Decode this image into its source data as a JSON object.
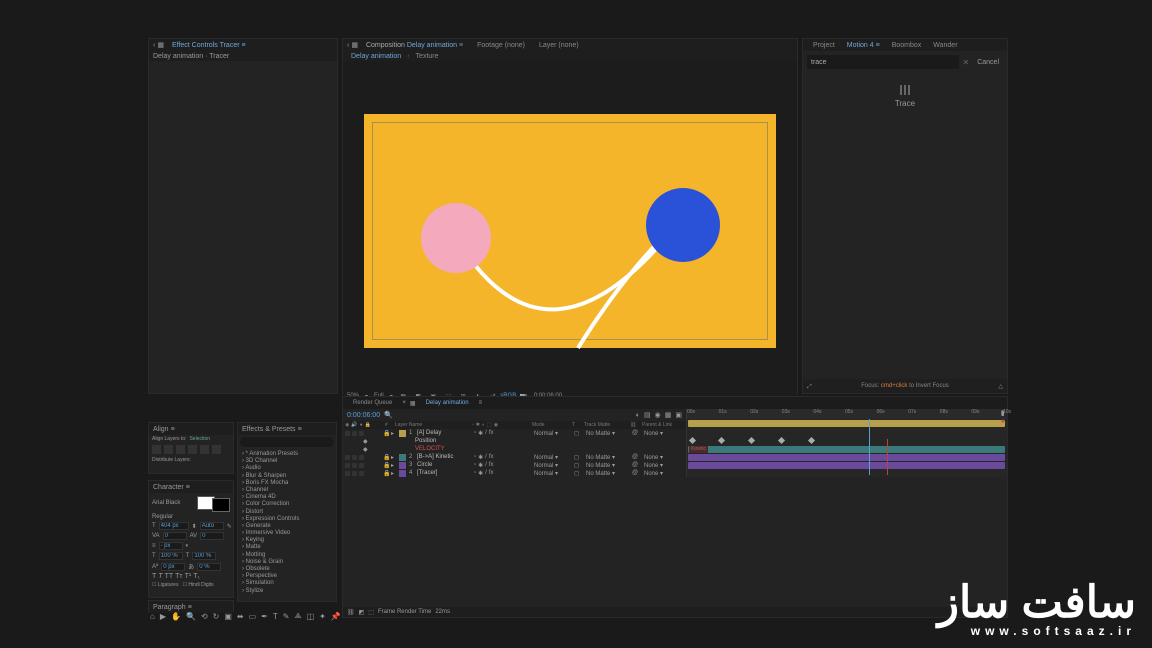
{
  "effect_controls": {
    "tab_prefix": "Effect Controls",
    "tab_layer": "Tracer",
    "breadcrumb": "Delay animation · Tracer"
  },
  "composition": {
    "tab_prefix": "Composition",
    "tab_name": "Delay animation",
    "tab_footage": "Footage (none)",
    "tab_layer": "Layer (none)",
    "subtab_delay": "Delay animation",
    "subtab_texture": "Texture"
  },
  "viewer_controls": {
    "zoom": "50%",
    "resolution": "Full",
    "colorspace": "sRGB",
    "timecode": "0:00:06:00"
  },
  "right_panel": {
    "tabs": [
      "Project",
      "Motion 4",
      "Boombox",
      "Wander"
    ],
    "active_tab_index": 1,
    "search_value": "trace",
    "cancel": "Cancel",
    "action_label": "Trace",
    "hint_prefix": "Focus:",
    "hint_cmd": "cmd+click",
    "hint_suffix": "to Invert Focus"
  },
  "timeline": {
    "tab_render": "Render Queue",
    "tab_comp": "Delay animation",
    "current_time": "0:00:06:00",
    "columns": {
      "layer_name": "Layer Name",
      "mode": "Mode",
      "trk": "Track Matte",
      "parent": "Parent & Link"
    },
    "layers": [
      {
        "idx": "1",
        "name": "[A] Delay",
        "color": "#b8a04a",
        "mode": "Normal",
        "trk": "No Matte",
        "parent": "None"
      },
      {
        "idx": "",
        "name": "Position",
        "child": true,
        "color": ""
      },
      {
        "idx": "",
        "name": "VELOCITY",
        "child": true,
        "color": "",
        "red": true
      },
      {
        "idx": "2",
        "name": "[B->A] Kinetic",
        "color": "#3a7a7a",
        "mode": "Normal",
        "trk": "No Matte",
        "parent": "None"
      },
      {
        "idx": "3",
        "name": "Circle",
        "color": "#6a4a9a",
        "mode": "Normal",
        "trk": "No Matte",
        "parent": "None"
      },
      {
        "idx": "4",
        "name": "[Tracer]",
        "color": "#6a4a9a",
        "mode": "Normal",
        "trk": "No Matte",
        "parent": "None"
      }
    ],
    "keyframe_label": "Kinetic",
    "ticks": [
      "00s",
      "01s",
      "02s",
      "03s",
      "04s",
      "05s",
      "06s",
      "07s",
      "08s",
      "09s",
      "10s"
    ],
    "footer": {
      "frame_render_prefix": "Frame Render Time",
      "frame_render_value": "22ms"
    }
  },
  "align": {
    "title": "Align",
    "layers_to": "Align Layers to:",
    "selection": "Selection",
    "distribute": "Distribute Layers:"
  },
  "character": {
    "title": "Character",
    "font": "Arial Black",
    "style": "Regular",
    "size": "404 px",
    "leading": "Auto",
    "kerning": "0",
    "tracking": "0",
    "vscale": "100 %",
    "hscale": "100 %",
    "baseline": "0 px",
    "tsume": "0 %",
    "lig": "Ligatures",
    "hindi": "Hindi Digits"
  },
  "paragraph": {
    "title": "Paragraph"
  },
  "effects_presets": {
    "title": "Effects & Presets",
    "items": [
      "* Animation Presets",
      "3D Channel",
      "Audio",
      "Blur & Sharpen",
      "Boris FX Mocha",
      "Channel",
      "Cinema 4D",
      "Color Correction",
      "Distort",
      "Expression Controls",
      "Generate",
      "Immersive Video",
      "Keying",
      "Matte",
      "Motting",
      "Noise & Grain",
      "Obsolete",
      "Perspective",
      "Simulation",
      "Stylize"
    ]
  },
  "watermark": {
    "url": "www.softsaaz.ir"
  }
}
